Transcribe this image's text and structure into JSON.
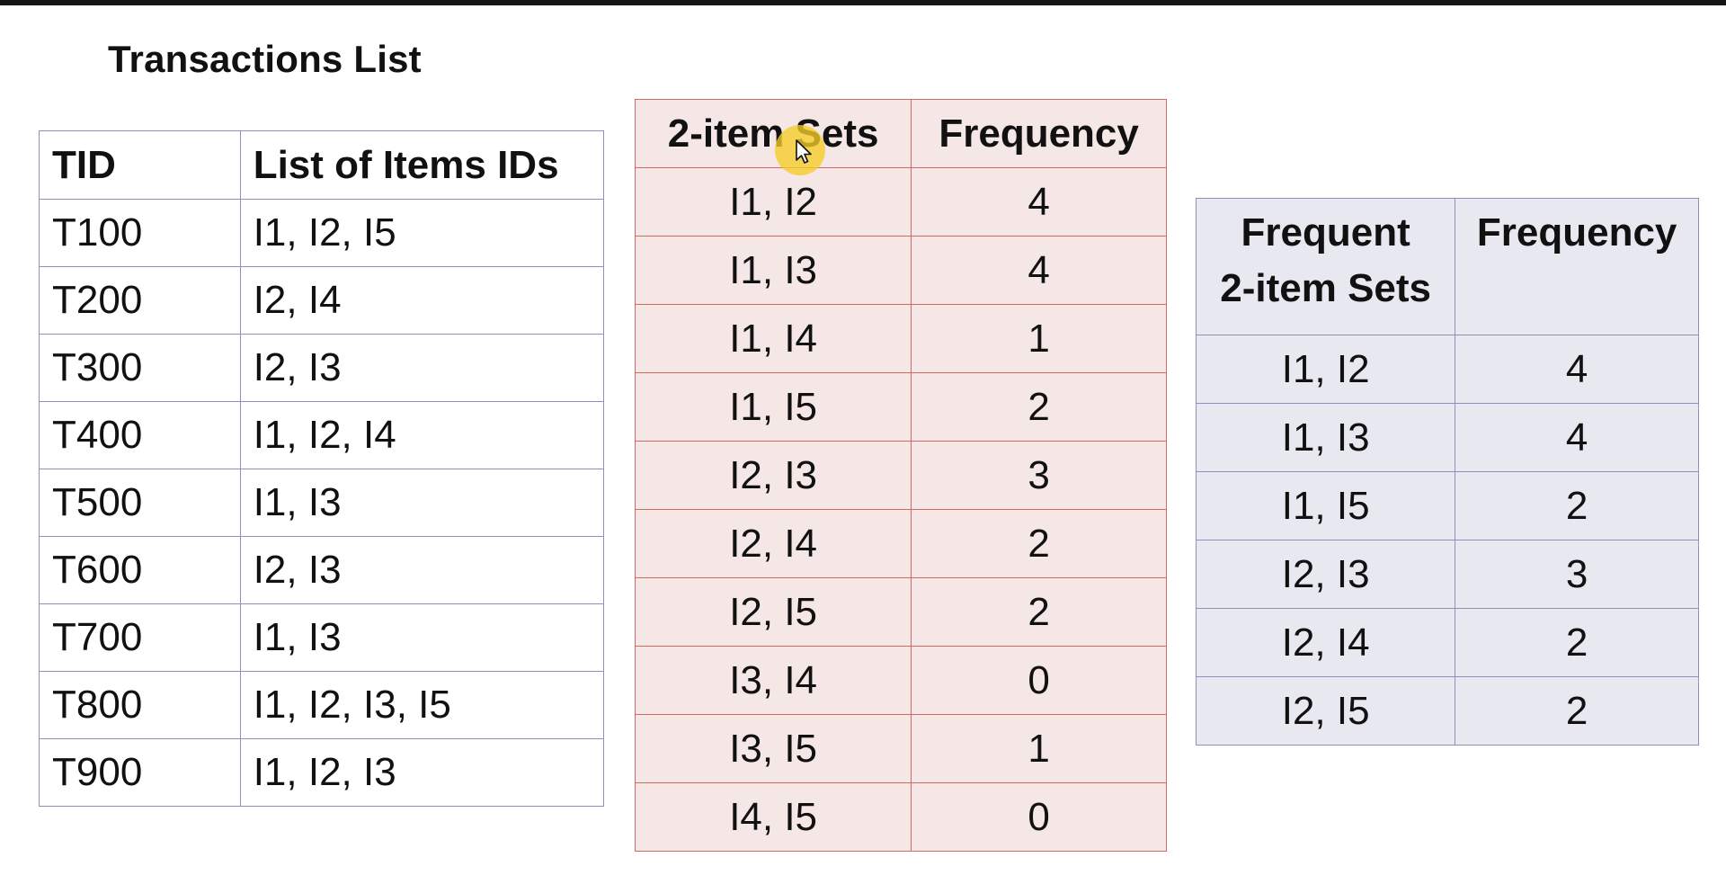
{
  "transactions": {
    "title": "Transactions List",
    "headers": [
      "TID",
      "List of Items IDs"
    ],
    "rows": [
      [
        "T100",
        "I1, I2, I5"
      ],
      [
        "T200",
        "I2, I4"
      ],
      [
        "T300",
        "I2, I3"
      ],
      [
        "T400",
        "I1, I2, I4"
      ],
      [
        "T500",
        "I1, I3"
      ],
      [
        "T600",
        "I2, I3"
      ],
      [
        "T700",
        "I1, I3"
      ],
      [
        "T800",
        "I1, I2, I3, I5"
      ],
      [
        "T900",
        "I1, I2, I3"
      ]
    ]
  },
  "candidates": {
    "headers": [
      "2-item Sets",
      "Frequency"
    ],
    "rows": [
      [
        "I1, I2",
        "4"
      ],
      [
        "I1, I3",
        "4"
      ],
      [
        "I1, I4",
        "1"
      ],
      [
        "I1, I5",
        "2"
      ],
      [
        "I2, I3",
        "3"
      ],
      [
        "I2, I4",
        "2"
      ],
      [
        "I2, I5",
        "2"
      ],
      [
        "I3, I4",
        "0"
      ],
      [
        "I3, I5",
        "1"
      ],
      [
        "I4, I5",
        "0"
      ]
    ]
  },
  "frequent": {
    "headers": [
      "Frequent",
      "2-item Sets",
      "Frequency"
    ],
    "rows": [
      [
        "I1, I2",
        "4"
      ],
      [
        "I1, I3",
        "4"
      ],
      [
        "I1, I5",
        "2"
      ],
      [
        "I2, I3",
        "3"
      ],
      [
        "I2, I4",
        "2"
      ],
      [
        "I2, I5",
        "2"
      ]
    ]
  },
  "colors": {
    "candidate_fill": "#f4e7e5",
    "candidate_border": "#d06a64",
    "frequent_fill": "#e8e8f0",
    "table_border": "#8f8fb8",
    "cursor_highlight": "#f5cd28"
  },
  "icons": {
    "cursor": "arrow-cursor-icon"
  }
}
